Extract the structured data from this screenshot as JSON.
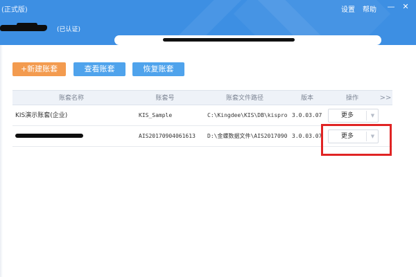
{
  "window": {
    "title": "(正式版)",
    "settings_label": "设置",
    "help_label": "帮助",
    "minimize_glyph": "—",
    "close_glyph": "✕"
  },
  "company": {
    "certified_label": "(已认证)"
  },
  "actions": {
    "new_label": "+新建账套",
    "view_label": "查看账套",
    "restore_label": "恢复账套"
  },
  "table": {
    "headers": {
      "name": "账套名称",
      "number": "账套号",
      "path": "账套文件路径",
      "version": "版本",
      "operation": "操作",
      "expand": ">>"
    },
    "rows": [
      {
        "name": "KIS演示账套(企业)",
        "number": "KIS_Sample",
        "path": "C:\\Kingdee\\KIS\\DB\\kispro\\",
        "version": "3.0.03.07",
        "action_label": "更多",
        "arrow_glyph": "▼"
      },
      {
        "name": "",
        "number": "AIS20170904061613",
        "path": "D:\\金蝶数据文件\\AIS2017090",
        "version": "3.0.03.07",
        "action_label": "更多",
        "arrow_glyph": "▼"
      }
    ]
  },
  "colors": {
    "header_bg": "#3d8fe3",
    "new_button": "#f39b4f",
    "blue_button": "#4fa3ec",
    "highlight": "#e02424"
  }
}
